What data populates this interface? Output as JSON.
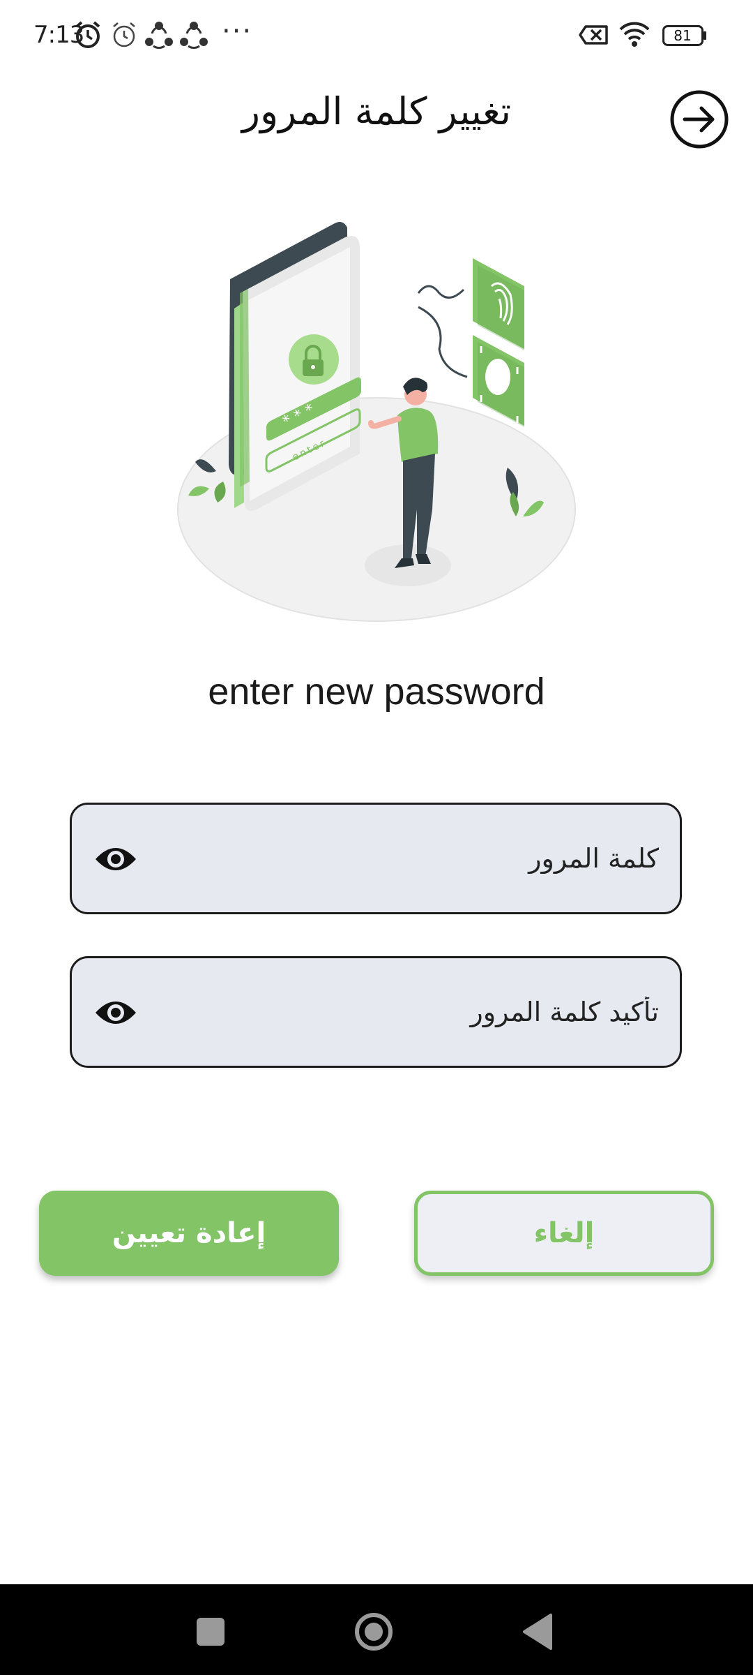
{
  "status_bar": {
    "time": "7:13",
    "battery_level": "81",
    "icons": [
      "alarm-icon",
      "alarm-outline-icon",
      "share-icon",
      "share-icon",
      "more-dots-icon",
      "sim-off-icon",
      "wifi-icon",
      "battery-icon"
    ],
    "more_text": "···"
  },
  "header": {
    "title": "تغيير كلمة المرور",
    "back_icon": "arrow-right-circle-icon"
  },
  "illustration": {
    "label": "enter",
    "accent_color": "#82c466"
  },
  "subtitle": "enter new password",
  "form": {
    "password_placeholder": "كلمة المرور",
    "confirm_placeholder": "تأكيد كلمة المرور",
    "visibility_icon": "eye-icon"
  },
  "actions": {
    "reset_label": "إعادة تعيين",
    "cancel_label": "إلغاء",
    "accent_color": "#82c466"
  },
  "nav": {
    "icons": [
      "recents-square-icon",
      "home-circle-icon",
      "back-triangle-icon"
    ]
  }
}
